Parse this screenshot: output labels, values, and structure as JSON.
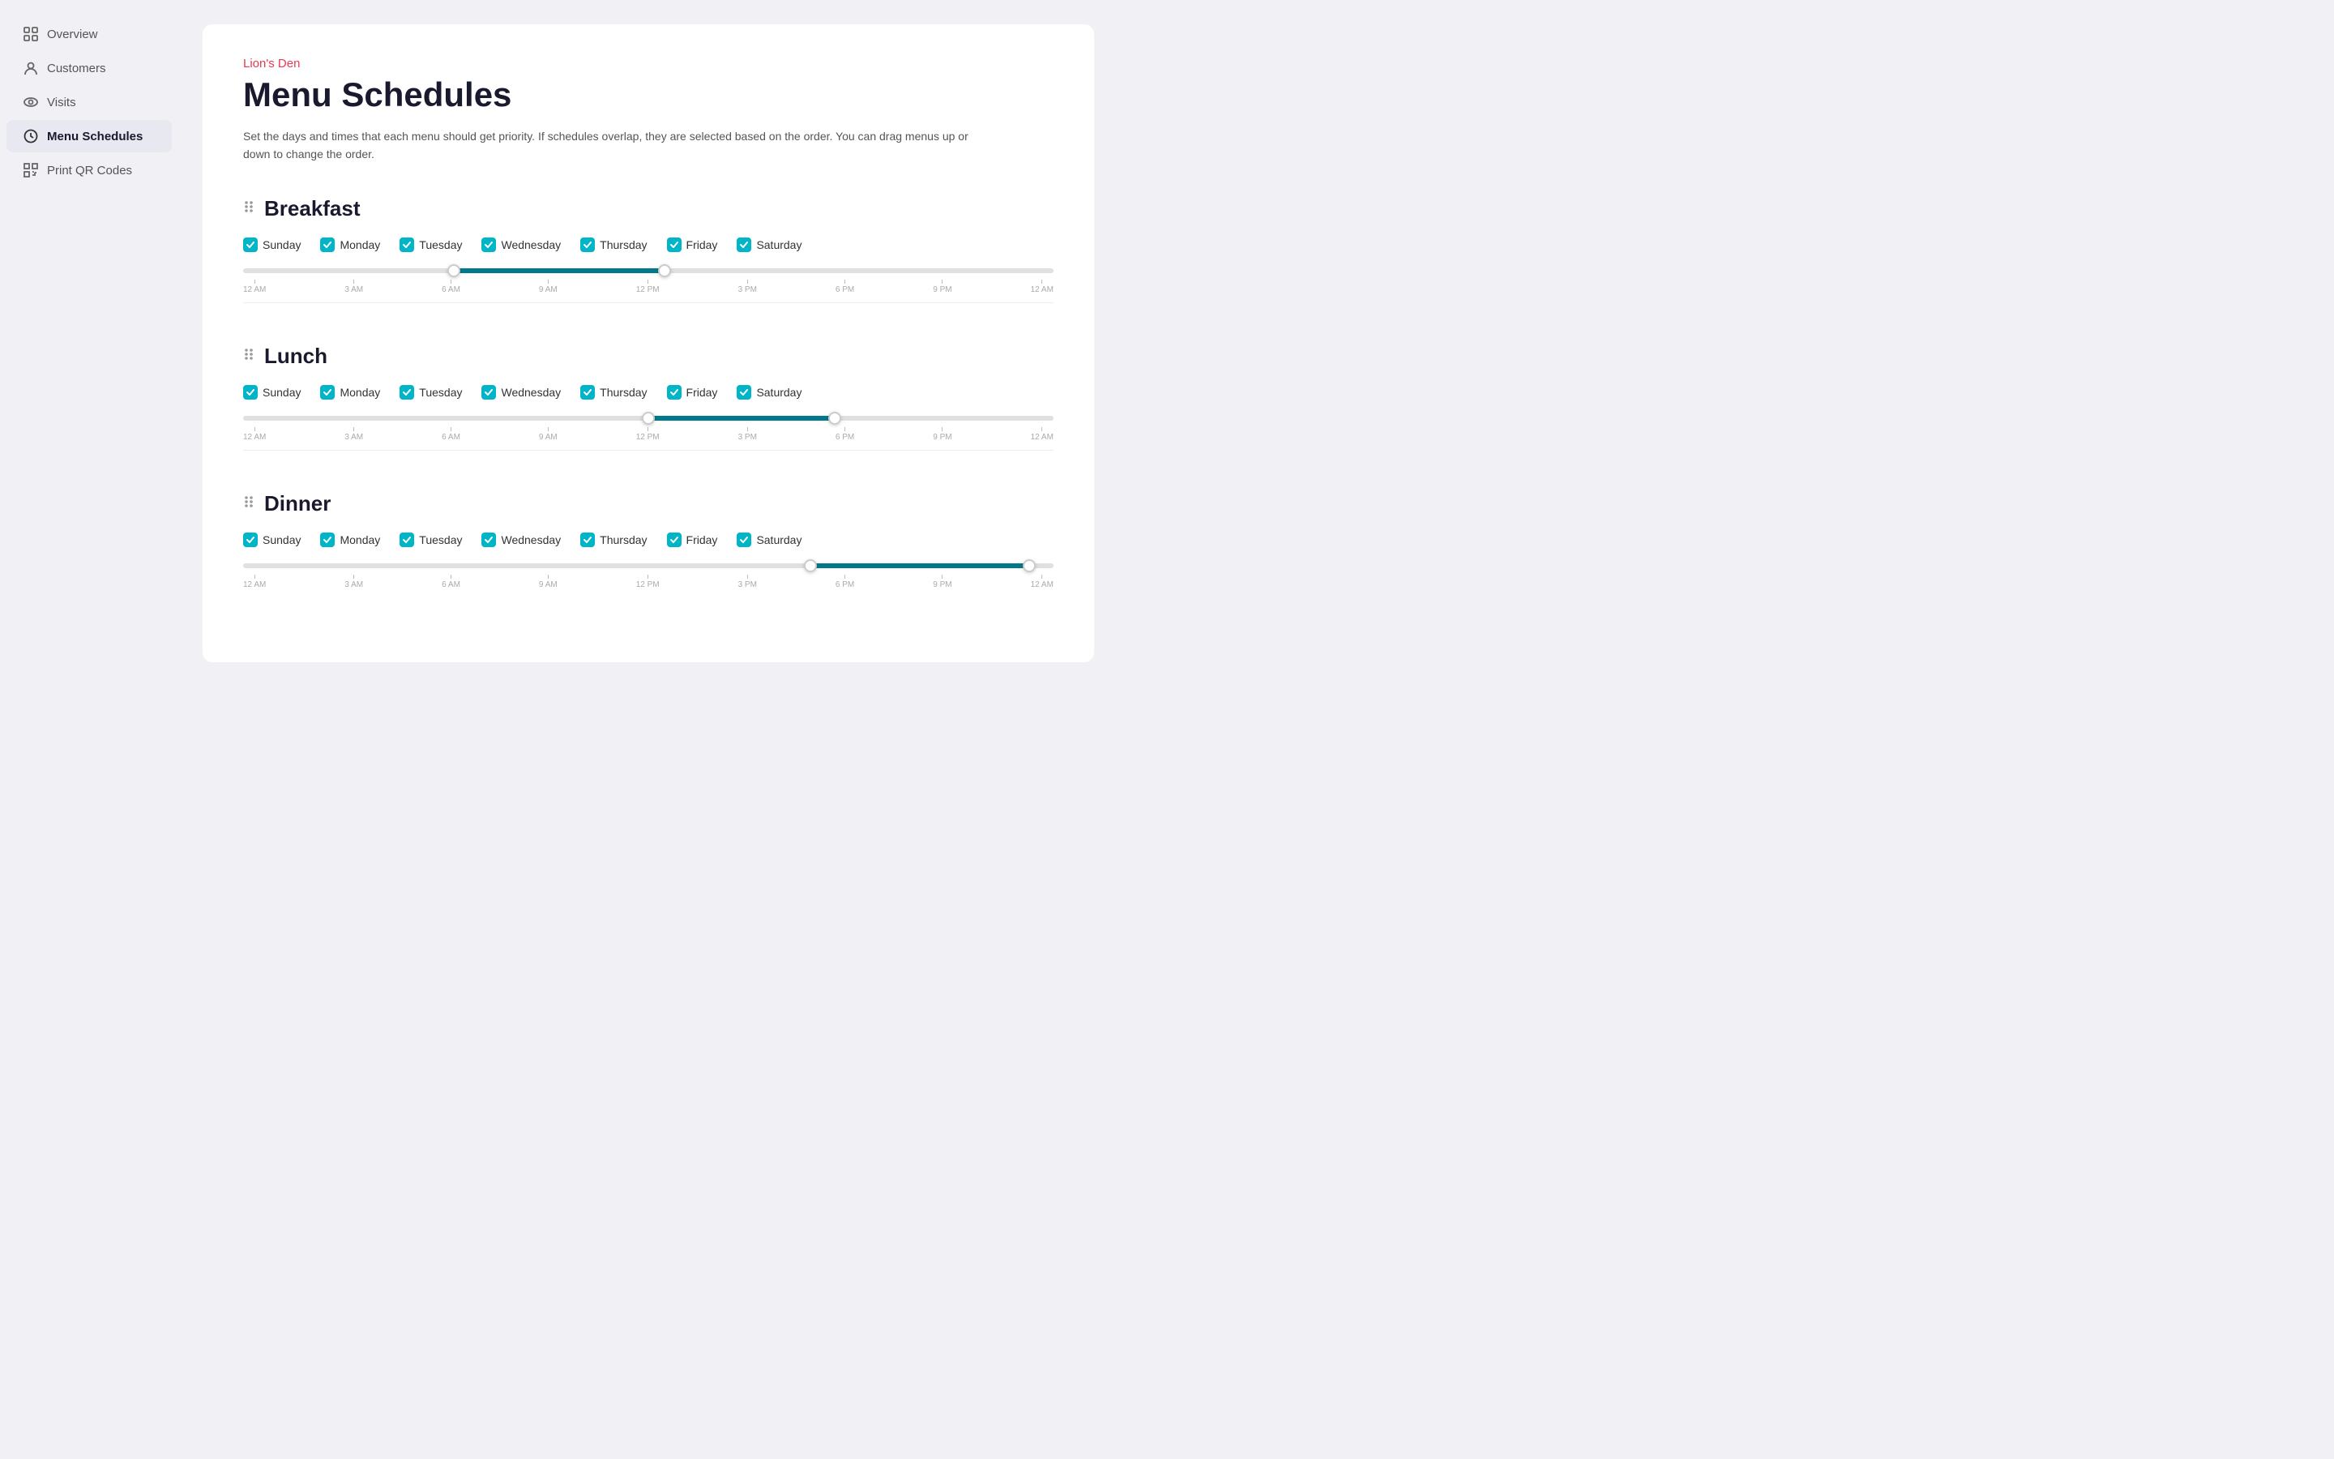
{
  "sidebar": {
    "items": [
      {
        "id": "overview",
        "label": "Overview",
        "icon": "grid"
      },
      {
        "id": "customers",
        "label": "Customers",
        "icon": "person"
      },
      {
        "id": "visits",
        "label": "Visits",
        "icon": "eye"
      },
      {
        "id": "menu-schedules",
        "label": "Menu Schedules",
        "icon": "clock",
        "active": true
      },
      {
        "id": "print-qr-codes",
        "label": "Print QR Codes",
        "icon": "qr"
      }
    ]
  },
  "header": {
    "brand": "Lion's Den",
    "title": "Menu Schedules",
    "description": "Set the days and times that each menu should get priority. If schedules overlap, they are selected based on the order. You can drag menus up or down to change the order."
  },
  "menus": [
    {
      "id": "breakfast",
      "name": "Breakfast",
      "days": [
        {
          "label": "Sunday",
          "checked": true
        },
        {
          "label": "Monday",
          "checked": true
        },
        {
          "label": "Tuesday",
          "checked": true
        },
        {
          "label": "Wednesday",
          "checked": true
        },
        {
          "label": "Thursday",
          "checked": true
        },
        {
          "label": "Friday",
          "checked": true
        },
        {
          "label": "Saturday",
          "checked": true
        }
      ],
      "slider": {
        "startPercent": 26,
        "endPercent": 52,
        "startTime": "6 AM",
        "endTime": "12 PM"
      }
    },
    {
      "id": "lunch",
      "name": "Lunch",
      "days": [
        {
          "label": "Sunday",
          "checked": true
        },
        {
          "label": "Monday",
          "checked": true
        },
        {
          "label": "Tuesday",
          "checked": true
        },
        {
          "label": "Wednesday",
          "checked": true
        },
        {
          "label": "Thursday",
          "checked": true
        },
        {
          "label": "Friday",
          "checked": true
        },
        {
          "label": "Saturday",
          "checked": true
        }
      ],
      "slider": {
        "startPercent": 50,
        "endPercent": 73,
        "startTime": "12 PM",
        "endTime": "5 PM"
      }
    },
    {
      "id": "dinner",
      "name": "Dinner",
      "days": [
        {
          "label": "Sunday",
          "checked": true
        },
        {
          "label": "Monday",
          "checked": true
        },
        {
          "label": "Tuesday",
          "checked": true
        },
        {
          "label": "Wednesday",
          "checked": true
        },
        {
          "label": "Thursday",
          "checked": true
        },
        {
          "label": "Friday",
          "checked": true
        },
        {
          "label": "Saturday",
          "checked": true
        }
      ],
      "slider": {
        "startPercent": 70,
        "endPercent": 97,
        "startTime": "5 PM",
        "endTime": "11 PM"
      }
    }
  ],
  "timeLabels": [
    "12 AM",
    "3 AM",
    "6 AM",
    "9 AM",
    "12 PM",
    "3 PM",
    "6 PM",
    "9 PM",
    "12 AM"
  ]
}
